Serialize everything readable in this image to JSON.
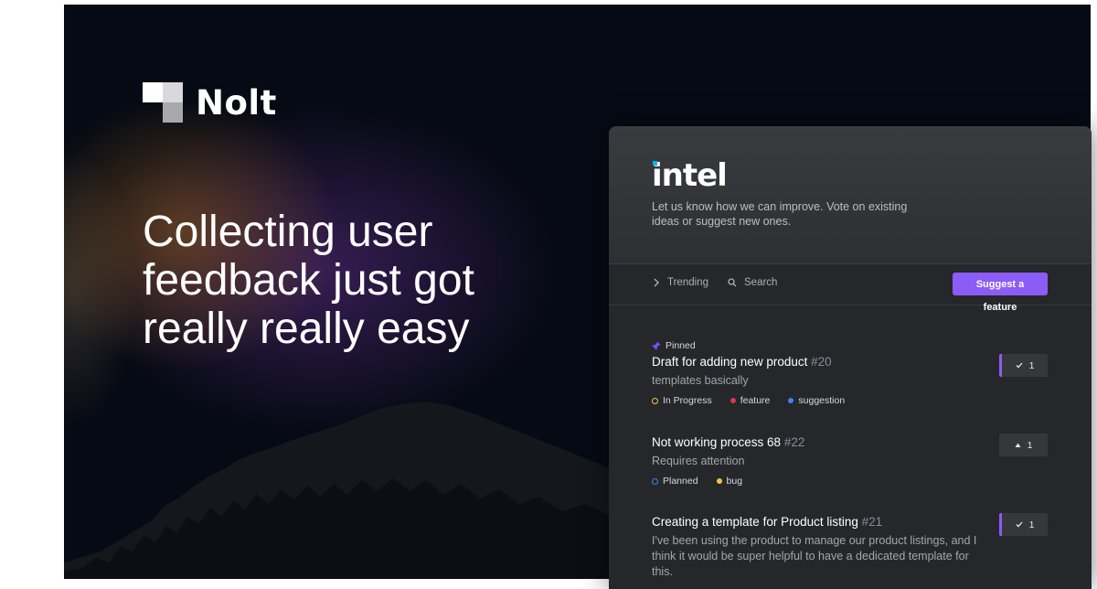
{
  "brand": {
    "name": "Nolt",
    "logo_icon": "nolt-logo-icon"
  },
  "headline": "Collecting user feedback just got really really easy",
  "panel": {
    "company_logo": "intel",
    "intro": "Let us know how we can improve. Vote on existing ideas or suggest new ones.",
    "toolbar": {
      "trending_label": "Trending",
      "search_label": "Search",
      "suggest_label": "Suggest a feature"
    },
    "posts": [
      {
        "pinned_label": "Pinned",
        "title": "Draft for adding new product",
        "number": "#20",
        "description": "templates basically",
        "status": {
          "label": "In Progress",
          "color": "#f5c542"
        },
        "tags": [
          {
            "label": "feature",
            "color": "#e0334c"
          },
          {
            "label": "suggestion",
            "color": "#3b82f6"
          }
        ],
        "votes": "1",
        "voted": true
      },
      {
        "title": "Not working process 68",
        "number": "#22",
        "description": "Requires attention",
        "status": {
          "label": "Planned",
          "color": "#3b82f6"
        },
        "tags": [
          {
            "label": "bug",
            "color": "#f5c542"
          }
        ],
        "votes": "1",
        "voted": false
      },
      {
        "title": "Creating a template for Product listing",
        "number": "#21",
        "description": "I've been using the product to manage our product listings, and I think it would be super helpful to have a dedicated template for this.",
        "votes": "1",
        "voted": true
      }
    ]
  },
  "colors": {
    "accent": "#8b5cf6",
    "background": "#060a14",
    "panel": "#26272b"
  }
}
